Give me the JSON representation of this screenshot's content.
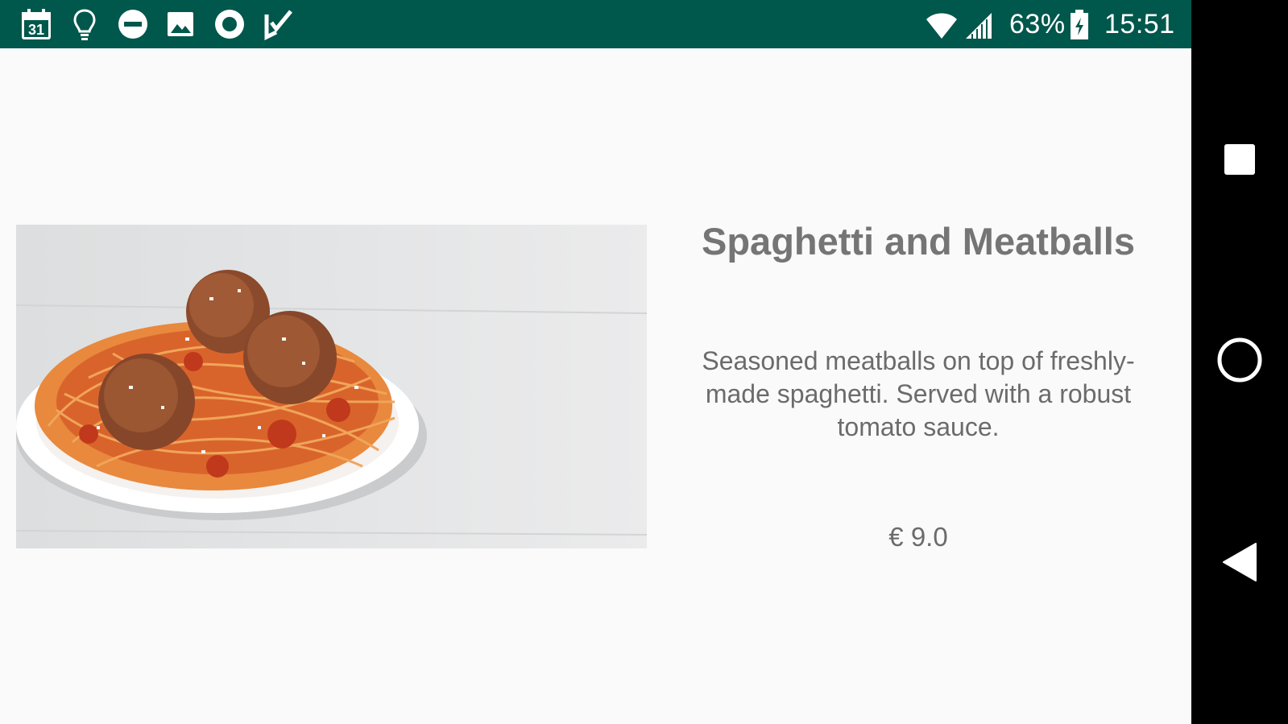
{
  "status_bar": {
    "calendar_day": "31",
    "battery": "63%",
    "time": "15:51",
    "background_color": "#00574b",
    "icons": [
      "calendar-icon",
      "lightbulb-icon",
      "do-not-disturb-icon",
      "image-icon",
      "record-icon",
      "checkmark-app-icon",
      "wifi-icon",
      "signal-icon",
      "battery-charging-icon"
    ]
  },
  "dish": {
    "title": "Spaghetti and Meatballs",
    "description": "Seasoned meatballs on top of freshly-made spaghetti. Served with a robust tomato sauce.",
    "price": "€ 9.0"
  },
  "nav_bar": {
    "icons": [
      "recents-square-icon",
      "home-circle-icon",
      "back-triangle-icon"
    ]
  }
}
